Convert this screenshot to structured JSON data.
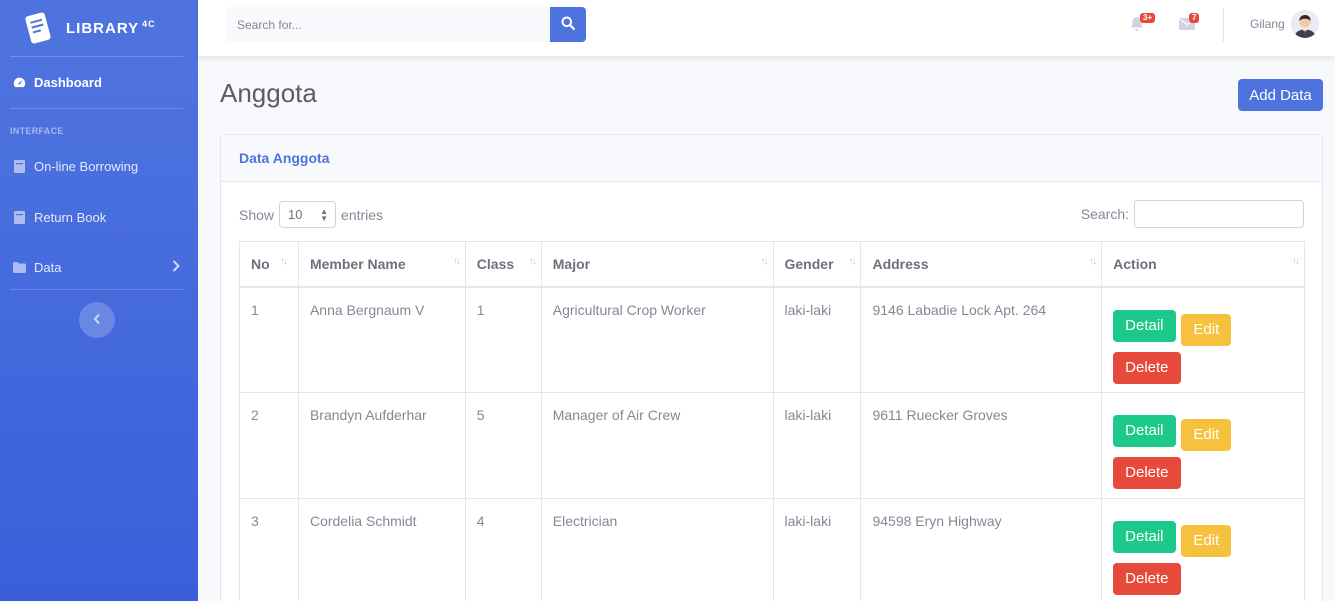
{
  "brand": {
    "name": "LIBRARY",
    "sup": "4C"
  },
  "sidebar": {
    "dashboard": "Dashboard",
    "heading": "INTERFACE",
    "items": [
      {
        "label": "On-line Borrowing",
        "icon": "book-icon"
      },
      {
        "label": "Return Book",
        "icon": "book-icon"
      },
      {
        "label": "Data",
        "icon": "folder-icon"
      }
    ]
  },
  "topbar": {
    "search_placeholder": "Search for...",
    "alerts_badge": "3+",
    "messages_badge": "7",
    "username": "Gilang"
  },
  "page": {
    "title": "Anggota",
    "add_button": "Add Data"
  },
  "card": {
    "title": "Data Anggota",
    "show_label": "Show",
    "entries_value": "10",
    "entries_label": "entries",
    "search_label": "Search:"
  },
  "table": {
    "headers": [
      "No",
      "Member Name",
      "Class",
      "Major",
      "Gender",
      "Address",
      "Action"
    ],
    "rows": [
      {
        "no": "1",
        "name": "Anna Bergnaum V",
        "class": "1",
        "major": "Agricultural Crop Worker",
        "gender": "laki-laki",
        "address": "9146 Labadie Lock Apt. 264"
      },
      {
        "no": "2",
        "name": "Brandyn Aufderhar",
        "class": "5",
        "major": "Manager of Air Crew",
        "gender": "laki-laki",
        "address": "9611 Ruecker Groves"
      },
      {
        "no": "3",
        "name": "Cordelia Schmidt",
        "class": "4",
        "major": "Electrician",
        "gender": "laki-laki",
        "address": "94598 Eryn Highway"
      }
    ],
    "actions": {
      "detail": "Detail",
      "edit": "Edit",
      "delete": "Delete"
    }
  },
  "colors": {
    "primary": "#4e73df",
    "success": "#1cc88a",
    "warning": "#f6c23e",
    "danger": "#e74a3b"
  }
}
